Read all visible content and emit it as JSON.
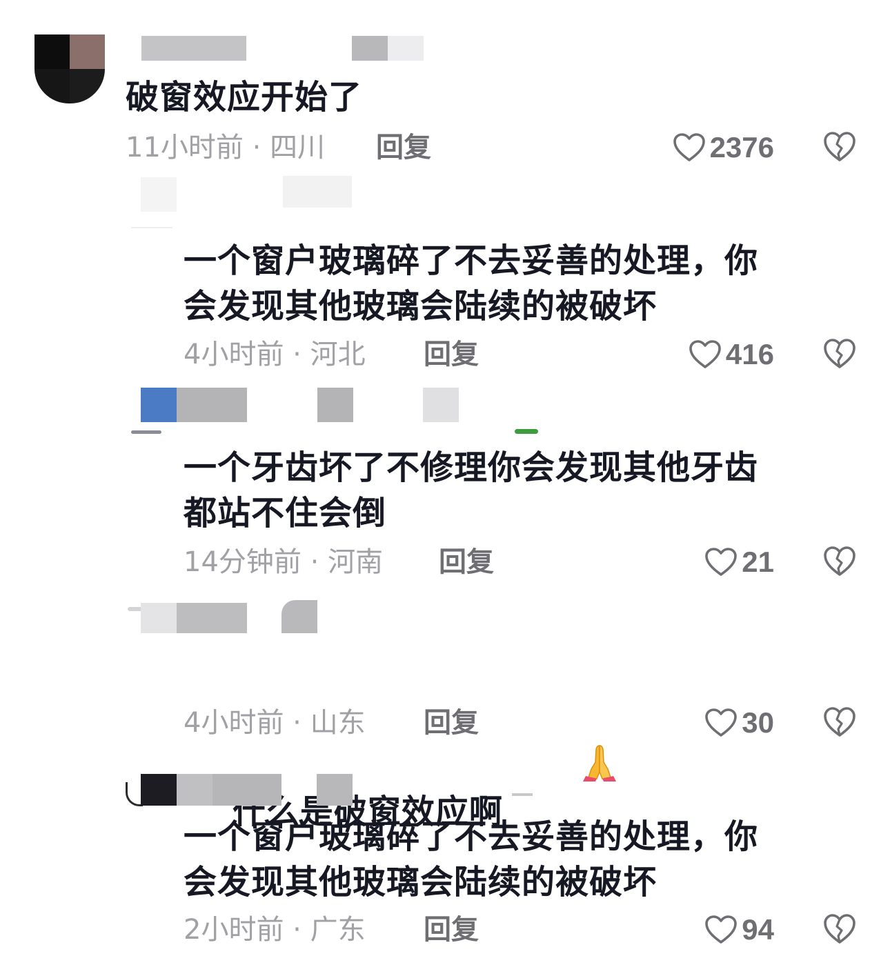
{
  "comments": [
    {
      "text": "破窗效应开始了",
      "time": "11小时前",
      "separator": "·",
      "location": "四川",
      "reply_label": "回复",
      "likes": "2376"
    },
    {
      "text": "一个窗户玻璃碎了不去妥善的处理，你\n会发现其他玻璃会陆续的被破坏",
      "time": "4小时前",
      "separator": "·",
      "location": "河北",
      "reply_label": "回复",
      "likes": "416"
    },
    {
      "text": "一个牙齿坏了不修理你会发现其他牙齿\n都站不住会倒",
      "time": "14分钟前",
      "separator": "·",
      "location": "河南",
      "reply_label": "回复",
      "likes": "21"
    },
    {
      "text": "什么是破窗效应啊",
      "time": "4小时前",
      "separator": "·",
      "location": "山东",
      "reply_label": "回复",
      "likes": "30"
    },
    {
      "text": "一个窗户玻璃碎了不去妥善的处理，你\n会发现其他玻璃会陆续的被破坏",
      "time": "2小时前",
      "separator": "·",
      "location": "广东",
      "reply_label": "回复",
      "likes": "94"
    }
  ],
  "icons": {
    "like": "heart-outline-icon",
    "dislike": "broken-heart-icon",
    "emoji": "folded-hands-emoji"
  },
  "colors": {
    "text": "#161823",
    "meta": "#a0a0a5",
    "reply": "#6e6e73",
    "blur_gray": "#b4b4b6",
    "blur_blue": "#4a7bc4"
  }
}
